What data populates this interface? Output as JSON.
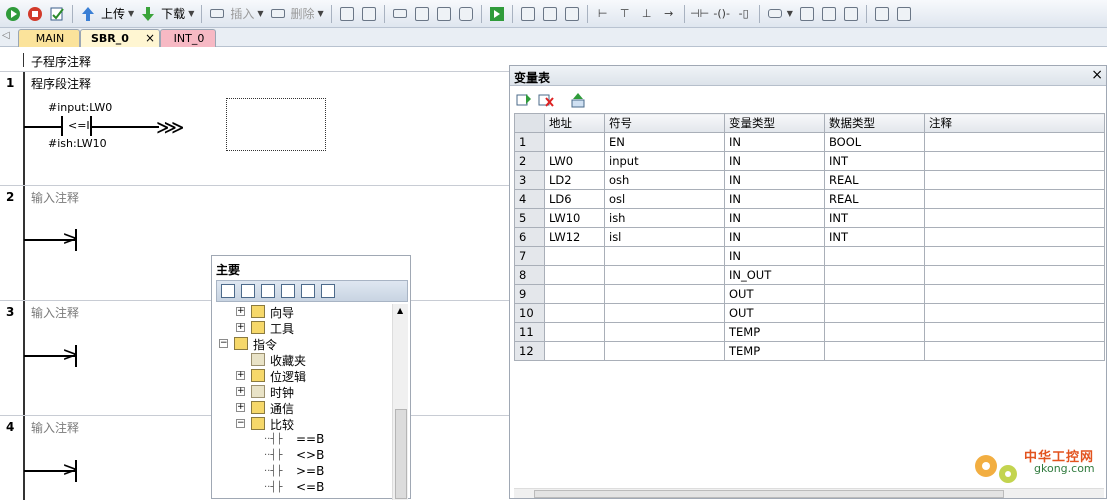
{
  "toolbar": {
    "upload_label": "上传",
    "download_label": "下载",
    "insert_label": "插入",
    "delete_label": "删除"
  },
  "tabs": [
    {
      "label": "MAIN"
    },
    {
      "label": "SBR_0"
    },
    {
      "label": "INT_0"
    }
  ],
  "editor": {
    "subroutine_comment": "子程序注释",
    "networks": [
      {
        "number": "1",
        "comment": "程序段注释",
        "in1": "#input:LW0",
        "op": "<=I",
        "in2": "#ish:LW10"
      },
      {
        "number": "2",
        "comment": "输入注释"
      },
      {
        "number": "3",
        "comment": "输入注释"
      },
      {
        "number": "4",
        "comment": "输入注释"
      }
    ]
  },
  "tree_panel": {
    "title": "主要",
    "items": [
      {
        "label": "向导"
      },
      {
        "label": "工具"
      },
      {
        "label": "指令"
      },
      {
        "label": "收藏夹"
      },
      {
        "label": "位逻辑"
      },
      {
        "label": "时钟"
      },
      {
        "label": "通信"
      },
      {
        "label": "比较"
      },
      {
        "label": "==B"
      },
      {
        "label": "<>B"
      },
      {
        "label": ">=B"
      },
      {
        "label": "<=B"
      }
    ]
  },
  "var_table": {
    "title": "变量表",
    "columns": [
      "",
      "地址",
      "符号",
      "变量类型",
      "数据类型",
      "注释"
    ],
    "rows": [
      [
        "1",
        "",
        "EN",
        "IN",
        "BOOL",
        ""
      ],
      [
        "2",
        "LW0",
        "input",
        "IN",
        "INT",
        ""
      ],
      [
        "3",
        "LD2",
        "osh",
        "IN",
        "REAL",
        ""
      ],
      [
        "4",
        "LD6",
        "osl",
        "IN",
        "REAL",
        ""
      ],
      [
        "5",
        "LW10",
        "ish",
        "IN",
        "INT",
        ""
      ],
      [
        "6",
        "LW12",
        "isl",
        "IN",
        "INT",
        ""
      ],
      [
        "7",
        "",
        "",
        "IN",
        "",
        ""
      ],
      [
        "8",
        "",
        "",
        "IN_OUT",
        "",
        ""
      ],
      [
        "9",
        "",
        "",
        "OUT",
        "",
        ""
      ],
      [
        "10",
        "",
        "",
        "OUT",
        "",
        ""
      ],
      [
        "11",
        "",
        "",
        "TEMP",
        "",
        ""
      ],
      [
        "12",
        "",
        "",
        "TEMP",
        "",
        ""
      ]
    ]
  },
  "watermark": {
    "cn": "中华工控网",
    "en": "gkong.com"
  }
}
